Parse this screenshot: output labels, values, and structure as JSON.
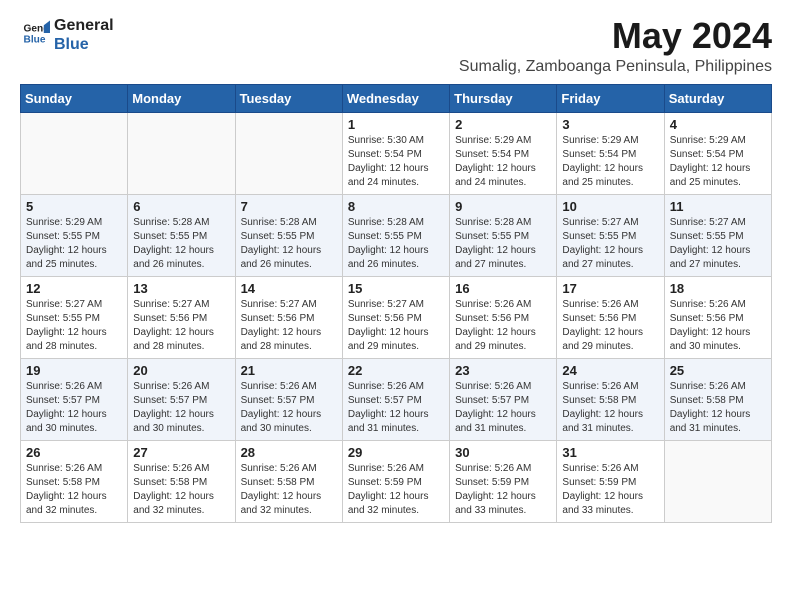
{
  "logo": {
    "line1": "General",
    "line2": "Blue"
  },
  "title": "May 2024",
  "location": "Sumalig, Zamboanga Peninsula, Philippines",
  "days_header": [
    "Sunday",
    "Monday",
    "Tuesday",
    "Wednesday",
    "Thursday",
    "Friday",
    "Saturday"
  ],
  "weeks": [
    [
      {
        "day": "",
        "info": ""
      },
      {
        "day": "",
        "info": ""
      },
      {
        "day": "",
        "info": ""
      },
      {
        "day": "1",
        "info": "Sunrise: 5:30 AM\nSunset: 5:54 PM\nDaylight: 12 hours\nand 24 minutes."
      },
      {
        "day": "2",
        "info": "Sunrise: 5:29 AM\nSunset: 5:54 PM\nDaylight: 12 hours\nand 24 minutes."
      },
      {
        "day": "3",
        "info": "Sunrise: 5:29 AM\nSunset: 5:54 PM\nDaylight: 12 hours\nand 25 minutes."
      },
      {
        "day": "4",
        "info": "Sunrise: 5:29 AM\nSunset: 5:54 PM\nDaylight: 12 hours\nand 25 minutes."
      }
    ],
    [
      {
        "day": "5",
        "info": "Sunrise: 5:29 AM\nSunset: 5:55 PM\nDaylight: 12 hours\nand 25 minutes."
      },
      {
        "day": "6",
        "info": "Sunrise: 5:28 AM\nSunset: 5:55 PM\nDaylight: 12 hours\nand 26 minutes."
      },
      {
        "day": "7",
        "info": "Sunrise: 5:28 AM\nSunset: 5:55 PM\nDaylight: 12 hours\nand 26 minutes."
      },
      {
        "day": "8",
        "info": "Sunrise: 5:28 AM\nSunset: 5:55 PM\nDaylight: 12 hours\nand 26 minutes."
      },
      {
        "day": "9",
        "info": "Sunrise: 5:28 AM\nSunset: 5:55 PM\nDaylight: 12 hours\nand 27 minutes."
      },
      {
        "day": "10",
        "info": "Sunrise: 5:27 AM\nSunset: 5:55 PM\nDaylight: 12 hours\nand 27 minutes."
      },
      {
        "day": "11",
        "info": "Sunrise: 5:27 AM\nSunset: 5:55 PM\nDaylight: 12 hours\nand 27 minutes."
      }
    ],
    [
      {
        "day": "12",
        "info": "Sunrise: 5:27 AM\nSunset: 5:55 PM\nDaylight: 12 hours\nand 28 minutes."
      },
      {
        "day": "13",
        "info": "Sunrise: 5:27 AM\nSunset: 5:56 PM\nDaylight: 12 hours\nand 28 minutes."
      },
      {
        "day": "14",
        "info": "Sunrise: 5:27 AM\nSunset: 5:56 PM\nDaylight: 12 hours\nand 28 minutes."
      },
      {
        "day": "15",
        "info": "Sunrise: 5:27 AM\nSunset: 5:56 PM\nDaylight: 12 hours\nand 29 minutes."
      },
      {
        "day": "16",
        "info": "Sunrise: 5:26 AM\nSunset: 5:56 PM\nDaylight: 12 hours\nand 29 minutes."
      },
      {
        "day": "17",
        "info": "Sunrise: 5:26 AM\nSunset: 5:56 PM\nDaylight: 12 hours\nand 29 minutes."
      },
      {
        "day": "18",
        "info": "Sunrise: 5:26 AM\nSunset: 5:56 PM\nDaylight: 12 hours\nand 30 minutes."
      }
    ],
    [
      {
        "day": "19",
        "info": "Sunrise: 5:26 AM\nSunset: 5:57 PM\nDaylight: 12 hours\nand 30 minutes."
      },
      {
        "day": "20",
        "info": "Sunrise: 5:26 AM\nSunset: 5:57 PM\nDaylight: 12 hours\nand 30 minutes."
      },
      {
        "day": "21",
        "info": "Sunrise: 5:26 AM\nSunset: 5:57 PM\nDaylight: 12 hours\nand 30 minutes."
      },
      {
        "day": "22",
        "info": "Sunrise: 5:26 AM\nSunset: 5:57 PM\nDaylight: 12 hours\nand 31 minutes."
      },
      {
        "day": "23",
        "info": "Sunrise: 5:26 AM\nSunset: 5:57 PM\nDaylight: 12 hours\nand 31 minutes."
      },
      {
        "day": "24",
        "info": "Sunrise: 5:26 AM\nSunset: 5:58 PM\nDaylight: 12 hours\nand 31 minutes."
      },
      {
        "day": "25",
        "info": "Sunrise: 5:26 AM\nSunset: 5:58 PM\nDaylight: 12 hours\nand 31 minutes."
      }
    ],
    [
      {
        "day": "26",
        "info": "Sunrise: 5:26 AM\nSunset: 5:58 PM\nDaylight: 12 hours\nand 32 minutes."
      },
      {
        "day": "27",
        "info": "Sunrise: 5:26 AM\nSunset: 5:58 PM\nDaylight: 12 hours\nand 32 minutes."
      },
      {
        "day": "28",
        "info": "Sunrise: 5:26 AM\nSunset: 5:58 PM\nDaylight: 12 hours\nand 32 minutes."
      },
      {
        "day": "29",
        "info": "Sunrise: 5:26 AM\nSunset: 5:59 PM\nDaylight: 12 hours\nand 32 minutes."
      },
      {
        "day": "30",
        "info": "Sunrise: 5:26 AM\nSunset: 5:59 PM\nDaylight: 12 hours\nand 33 minutes."
      },
      {
        "day": "31",
        "info": "Sunrise: 5:26 AM\nSunset: 5:59 PM\nDaylight: 12 hours\nand 33 minutes."
      },
      {
        "day": "",
        "info": ""
      }
    ]
  ]
}
